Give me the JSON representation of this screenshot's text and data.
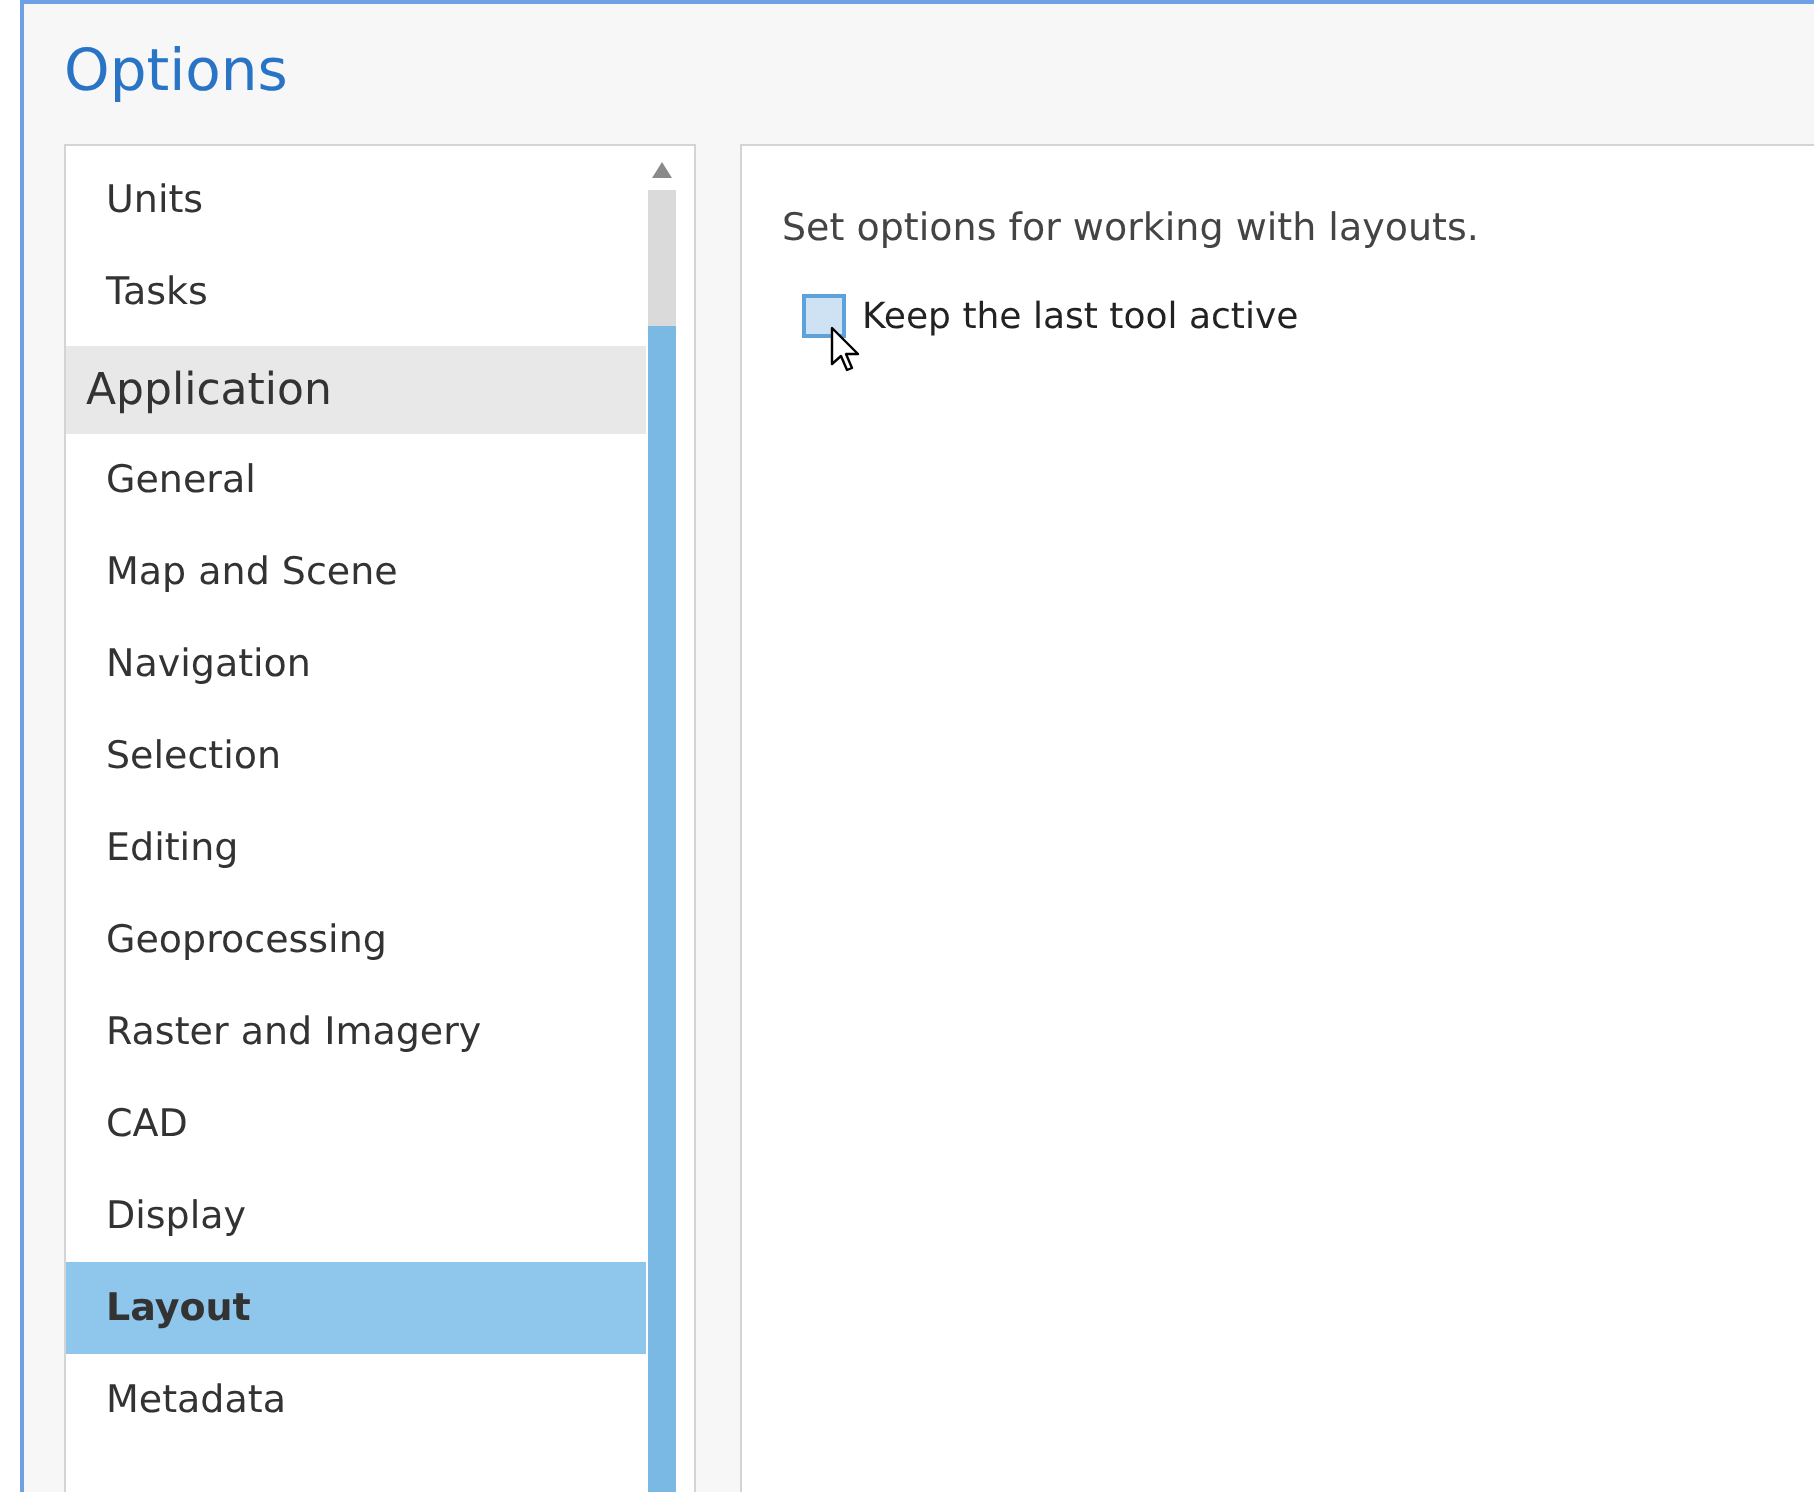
{
  "window": {
    "title": "Options"
  },
  "sidebar": {
    "items": [
      {
        "kind": "item",
        "label": "Units",
        "selected": false
      },
      {
        "kind": "item",
        "label": "Tasks",
        "selected": false
      },
      {
        "kind": "section",
        "label": "Application",
        "selected": false
      },
      {
        "kind": "item",
        "label": "General",
        "selected": false
      },
      {
        "kind": "item",
        "label": "Map and Scene",
        "selected": false
      },
      {
        "kind": "item",
        "label": "Navigation",
        "selected": false
      },
      {
        "kind": "item",
        "label": "Selection",
        "selected": false
      },
      {
        "kind": "item",
        "label": "Editing",
        "selected": false
      },
      {
        "kind": "item",
        "label": "Geoprocessing",
        "selected": false
      },
      {
        "kind": "item",
        "label": "Raster and Imagery",
        "selected": false
      },
      {
        "kind": "item",
        "label": "CAD",
        "selected": false
      },
      {
        "kind": "item",
        "label": "Display",
        "selected": false
      },
      {
        "kind": "item",
        "label": "Layout",
        "selected": true
      },
      {
        "kind": "item",
        "label": "Metadata",
        "selected": false
      }
    ]
  },
  "panel": {
    "heading": "Set options for working with layouts.",
    "options": [
      {
        "label": "Keep the last tool active",
        "checked": false,
        "hovered": true
      }
    ]
  }
}
